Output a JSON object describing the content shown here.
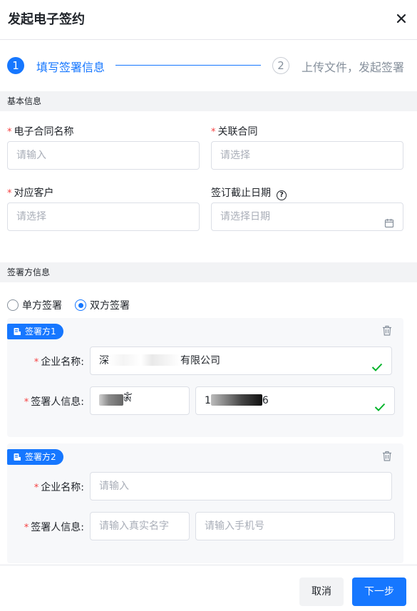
{
  "dialog": {
    "title": "发起电子签约"
  },
  "steps": [
    {
      "number": "1",
      "label": "填写签署信息",
      "active": true
    },
    {
      "number": "2",
      "label": "上传文件，发起签署",
      "active": false
    }
  ],
  "basic_info": {
    "section_title": "基本信息",
    "contract_name": {
      "label": "电子合同名称",
      "placeholder": "请输入"
    },
    "related_contract": {
      "label": "关联合同",
      "placeholder": "请选择"
    },
    "customer": {
      "label": "对应客户",
      "placeholder": "请选择"
    },
    "deadline": {
      "label": "签订截止日期",
      "placeholder": "请选择日期"
    }
  },
  "signer_info": {
    "section_title": "签署方信息",
    "sign_mode_options": [
      {
        "label": "单方签署",
        "checked": false
      },
      {
        "label": "双方签署",
        "checked": true
      }
    ],
    "parties": [
      {
        "tag": "签署方1",
        "company_label": "企业名称:",
        "company_value_prefix": "深",
        "company_value_suffix": "有限公司",
        "signer_label": "签署人信息:",
        "signer_name_tail": "ༀ",
        "phone_prefix": "1",
        "phone_suffix": "6"
      },
      {
        "tag": "签署方2",
        "company_label": "企业名称:",
        "company_placeholder": "请输入",
        "signer_label": "签署人信息:",
        "name_placeholder": "请输入真实名字",
        "phone_placeholder": "请输入手机号"
      }
    ]
  },
  "footer": {
    "cancel_label": "取消",
    "next_label": "下一步"
  },
  "colors": {
    "accent": "#1677ff",
    "success": "#00b42a",
    "required": "#f53f3f"
  }
}
